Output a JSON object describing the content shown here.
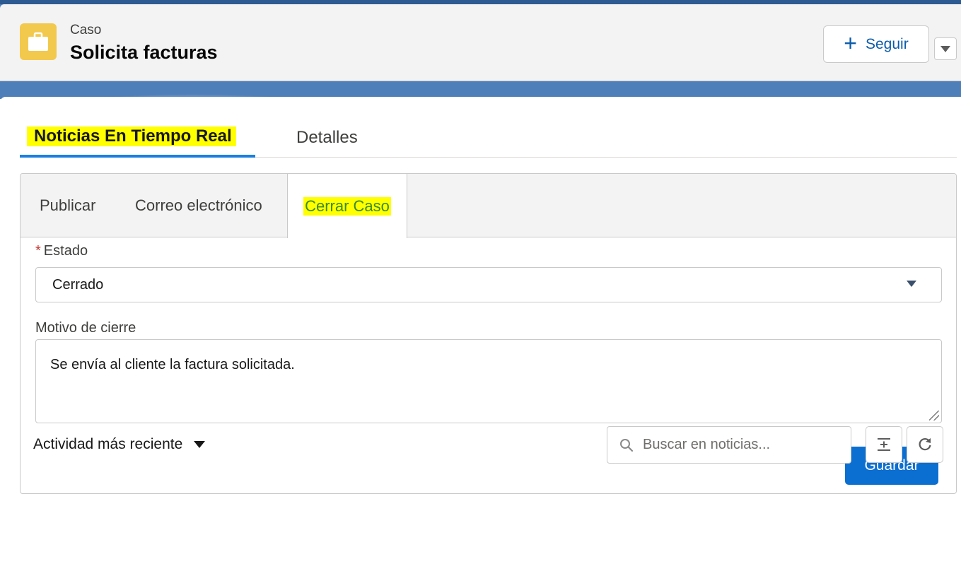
{
  "header": {
    "object_label": "Caso",
    "title": "Solicita facturas",
    "follow_label": "Seguir"
  },
  "main_tabs": [
    {
      "label": "Noticias En Tiempo Real",
      "active": true
    },
    {
      "label": "Detalles",
      "active": false
    }
  ],
  "publisher": {
    "tabs": [
      {
        "label": "Publicar",
        "active": false
      },
      {
        "label": "Correo electrónico",
        "active": false
      },
      {
        "label": "Cerrar Caso",
        "active": true
      }
    ],
    "status": {
      "required_mark": "*",
      "label": "Estado",
      "value": "Cerrado"
    },
    "reason": {
      "label": "Motivo de cierre",
      "value": "Se envía al cliente la factura solicitada."
    },
    "save_label": "Guardar"
  },
  "feed": {
    "sort_label": "Actividad más reciente",
    "search_placeholder": "Buscar en noticias..."
  },
  "colors": {
    "brand_blue": "#0b6fd1",
    "highlight": "#ffff00",
    "record_icon": "#f2c94c",
    "active_tab_underline": "#1b7fe0"
  },
  "icons": [
    "briefcase-icon",
    "plus-icon",
    "chevron-down-icon",
    "search-icon",
    "collapse-all-icon",
    "refresh-icon"
  ]
}
